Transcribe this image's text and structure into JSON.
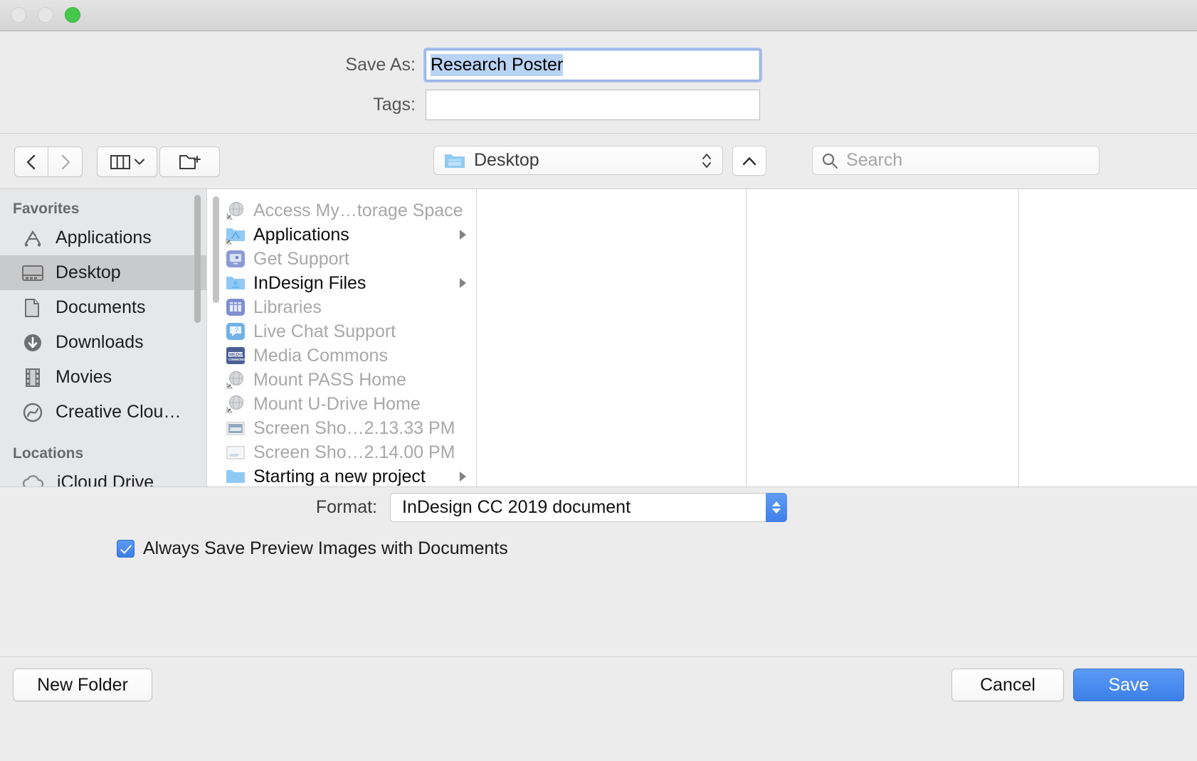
{
  "window": {
    "traffic_lights": [
      "close",
      "minimize",
      "zoom"
    ]
  },
  "save_as": {
    "label": "Save As:",
    "value": "Research Poster",
    "selected": true
  },
  "tags": {
    "label": "Tags:",
    "value": "",
    "placeholder": ""
  },
  "toolbar": {
    "back_icon": "chevron-left-icon",
    "forward_icon": "chevron-right-icon",
    "view_icon": "column-view-icon",
    "view_chevron_icon": "chevron-down-icon",
    "new_folder_icon": "new-folder-icon",
    "path_popup": {
      "icon": "folder-icon",
      "value": "Desktop",
      "stepper_icon": "updown-stepper-icon"
    },
    "collapse_button_icon": "chevron-up-icon",
    "search": {
      "icon": "search-icon",
      "placeholder": "Search",
      "value": ""
    }
  },
  "sidebar": {
    "sections": [
      {
        "header": "Favorites",
        "items": [
          {
            "label": "Applications",
            "icon": "applications-icon",
            "selected": false
          },
          {
            "label": "Desktop",
            "icon": "desktop-icon",
            "selected": true
          },
          {
            "label": "Documents",
            "icon": "documents-icon",
            "selected": false
          },
          {
            "label": "Downloads",
            "icon": "downloads-icon",
            "selected": false
          },
          {
            "label": "Movies",
            "icon": "movies-icon",
            "selected": false
          },
          {
            "label": "Creative Clou…",
            "icon": "creative-cloud-icon",
            "selected": false
          }
        ]
      },
      {
        "header": "Locations",
        "items": [
          {
            "label": "iCloud Drive",
            "icon": "icloud-icon",
            "selected": false
          }
        ]
      }
    ]
  },
  "file_list": {
    "items": [
      {
        "name": "Access My…torage Space",
        "icon": "network-alias-icon",
        "enabled": false,
        "has_children": false
      },
      {
        "name": "Applications",
        "icon": "applications-folder-alias-icon",
        "enabled": true,
        "has_children": true
      },
      {
        "name": "Get Support",
        "icon": "support-monitor-icon",
        "enabled": false,
        "has_children": false
      },
      {
        "name": "InDesign Files",
        "icon": "blue-folder-icon",
        "enabled": true,
        "has_children": true
      },
      {
        "name": "Libraries",
        "icon": "libraries-icon",
        "enabled": false,
        "has_children": false
      },
      {
        "name": "Live Chat Support",
        "icon": "chat-bubble-icon",
        "enabled": false,
        "has_children": false
      },
      {
        "name": "Media Commons",
        "icon": "media-commons-icon",
        "enabled": false,
        "has_children": false
      },
      {
        "name": "Mount PASS Home",
        "icon": "network-alias-icon",
        "enabled": false,
        "has_children": false
      },
      {
        "name": "Mount U-Drive Home",
        "icon": "network-alias-icon",
        "enabled": false,
        "has_children": false
      },
      {
        "name": "Screen Sho…2.13.33 PM",
        "icon": "screenshot-icon",
        "enabled": false,
        "has_children": false
      },
      {
        "name": "Screen Sho…2.14.00 PM",
        "icon": "screenshot-light-icon",
        "enabled": false,
        "has_children": false
      },
      {
        "name": "Starting a new project",
        "icon": "blue-folder-icon",
        "enabled": true,
        "has_children": true
      }
    ]
  },
  "format": {
    "label": "Format:",
    "value": "InDesign CC 2019 document",
    "stepper_icon": "updown-stepper-icon"
  },
  "preview_option": {
    "label": "Always Save Preview Images with Documents",
    "checked": true
  },
  "footer": {
    "new_folder_label": "New Folder",
    "cancel_label": "Cancel",
    "save_label": "Save"
  },
  "colors": {
    "accent_blue": "#3c7fe8",
    "selection_blue": "#b9d3f4",
    "window_bg": "#ececec",
    "sidebar_bg": "#e6e7e9",
    "sidebar_selected": "#c9cacc"
  }
}
